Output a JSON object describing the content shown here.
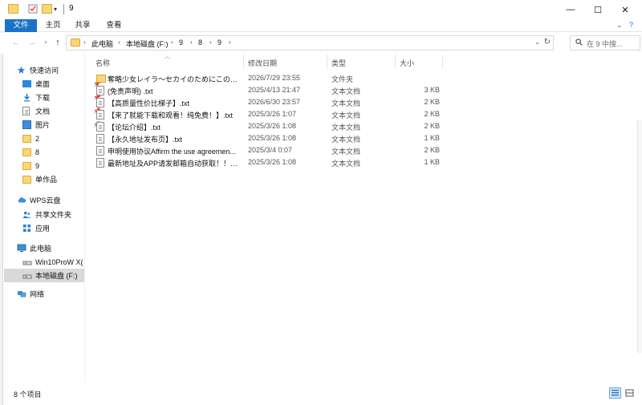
{
  "window": {
    "title": "9",
    "controls": {
      "minimize": "—",
      "maximize": "☐",
      "close": "✕"
    }
  },
  "ribbon": {
    "tabs": [
      "文件",
      "主页",
      "共享",
      "查看"
    ],
    "expand_glyph": "⌄",
    "help_glyph": "?"
  },
  "address": {
    "crumbs": [
      "此电脑",
      "本地磁盘 (F:)",
      "9",
      "8",
      "9"
    ],
    "separator": "›"
  },
  "search": {
    "placeholder": "在 9 中搜..."
  },
  "sidebar": {
    "quick_access": "快速访问",
    "quick_items": [
      {
        "label": "桌面",
        "icon": "desktop-icon",
        "pinned": true
      },
      {
        "label": "下载",
        "icon": "download-icon",
        "pinned": true
      },
      {
        "label": "文档",
        "icon": "document-icon",
        "pinned": true
      },
      {
        "label": "图片",
        "icon": "picture-icon",
        "pinned": true
      },
      {
        "label": "2",
        "icon": "folder-icon",
        "pinned": false
      },
      {
        "label": "8",
        "icon": "folder-icon",
        "pinned": false
      },
      {
        "label": "9",
        "icon": "folder-icon",
        "pinned": false
      },
      {
        "label": "单作品",
        "icon": "folder-icon",
        "pinned": false
      }
    ],
    "wps_cloud": "WPS云盘",
    "wps_items": [
      "共享文件夹",
      "应用"
    ],
    "this_pc": "此电脑",
    "drives": [
      "Win10ProW X(",
      "本地磁盘 (F:)"
    ],
    "network": "网络"
  },
  "columns": {
    "name": "名称",
    "date": "修改日期",
    "type": "类型",
    "size": "大小"
  },
  "files": [
    {
      "name": "奪略少女レイラ～セカイのためにこの身...",
      "date": "2026/7/29 23:55",
      "type": "文件夹",
      "size": "",
      "kind": "folder"
    },
    {
      "name": "(免责声明) .txt",
      "date": "2025/4/13 21:47",
      "type": "文本文档",
      "size": "3 KB",
      "kind": "txt"
    },
    {
      "name": "【高质量性价比梯子】.txt",
      "date": "2026/6/30 23:57",
      "type": "文本文档",
      "size": "2 KB",
      "kind": "txt"
    },
    {
      "name": "【来了就能下载和观看！纯免费！】.txt",
      "date": "2025/3/26 1:07",
      "type": "文本文档",
      "size": "2 KB",
      "kind": "txt"
    },
    {
      "name": "【论坛介绍】.txt",
      "date": "2025/3/26 1:08",
      "type": "文本文档",
      "size": "2 KB",
      "kind": "txt"
    },
    {
      "name": "【永久地址发布页】.txt",
      "date": "2025/3/26 1:08",
      "type": "文本文档",
      "size": "1 KB",
      "kind": "txt"
    },
    {
      "name": "申明使用协议Affirm the use agreemen...",
      "date": "2025/3/4 0:07",
      "type": "文本文档",
      "size": "2 KB",
      "kind": "txt"
    },
    {
      "name": "最新地址及APP请发邮箱自动获取！！！....",
      "date": "2025/3/26 1:08",
      "type": "文本文档",
      "size": "1 KB",
      "kind": "txt"
    }
  ],
  "status": {
    "item_count": "8 个项目"
  },
  "colors": {
    "accent": "#1a73c7",
    "folder": "#f8d775",
    "selected": "#d9d9d9"
  }
}
